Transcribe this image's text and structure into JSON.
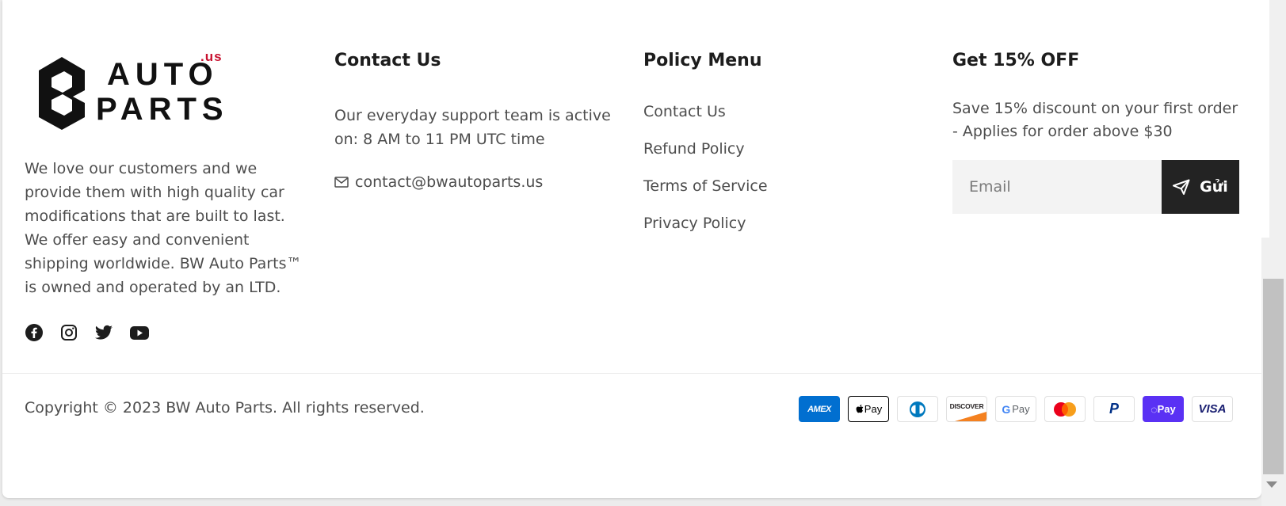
{
  "brand": {
    "logo_word1": "AUTO",
    "logo_word2": "PARTS",
    "logo_suffix": ".us",
    "logo_suffix_color": "#c8102e"
  },
  "about": {
    "text": "We love our customers and we provide them with high quality car modifications that are built to last. We offer easy and convenient shipping worldwide. BW Auto Parts™ is owned and operated by an LTD."
  },
  "socials": [
    {
      "icon": "facebook-icon"
    },
    {
      "icon": "instagram-icon"
    },
    {
      "icon": "twitter-icon"
    },
    {
      "icon": "youtube-icon"
    }
  ],
  "contact": {
    "heading": "Contact Us",
    "support_text": "Our everyday support team is active on: 8 AM to 11 PM UTC time",
    "email": "contact@bwautoparts.us",
    "email_icon": "mail-icon"
  },
  "policy": {
    "heading": "Policy Menu",
    "items": [
      "Contact Us",
      "Refund Policy",
      "Terms of Service",
      "Privacy Policy"
    ]
  },
  "newsletter": {
    "heading": "Get 15% OFF",
    "text": "Save 15% discount on your first order - Applies for order above $30",
    "email_placeholder": "Email",
    "submit_label": "Gửi",
    "submit_icon": "send-icon"
  },
  "footer": {
    "copyright": "Copyright © 2023 BW Auto Parts. All rights reserved."
  },
  "payments": [
    {
      "name": "AMEX",
      "bg": "#016fd0",
      "fg": "#ffffff"
    },
    {
      "name": "Pay",
      "bg": "#ffffff",
      "fg": "#000000"
    },
    {
      "name": "Diners",
      "bg": "#ffffff",
      "fg": "#0079be"
    },
    {
      "name": "DISCOVER",
      "bg": "#ffffff",
      "fg": "#231f20"
    },
    {
      "name": "G Pay",
      "bg": "#ffffff",
      "fg": "#5f6368"
    },
    {
      "name": "Mastercard",
      "bg": "#ffffff",
      "fg": "#eb001b"
    },
    {
      "name": "PayPal",
      "bg": "#ffffff",
      "fg": "#003087"
    },
    {
      "name": "Pay",
      "bg": "#5a31f4",
      "fg": "#ffffff"
    },
    {
      "name": "VISA",
      "bg": "#ffffff",
      "fg": "#1a1f71"
    }
  ]
}
